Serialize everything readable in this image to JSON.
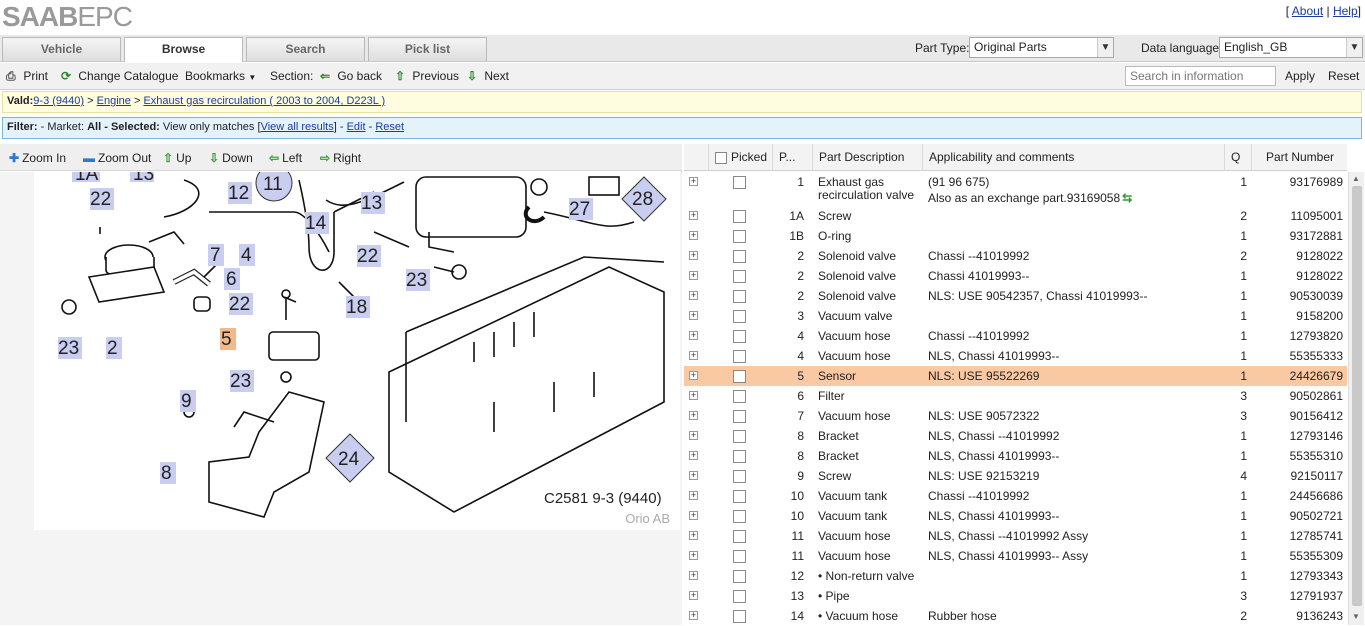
{
  "header": {
    "logo_saab": "SAAB",
    "logo_epc": "EPC",
    "about": "About",
    "help": "Help",
    "sep_open": "[",
    "sep_mid": "|",
    "sep_close": "]"
  },
  "tabs": [
    {
      "label": "Vehicle"
    },
    {
      "label": "Browse"
    },
    {
      "label": "Search"
    },
    {
      "label": "Pick list"
    }
  ],
  "part_type": {
    "label": "Part Type:",
    "value": "Original Parts"
  },
  "data_language": {
    "label": "Data language:",
    "value": "English_GB"
  },
  "toolbar": {
    "print": "Print",
    "change_catalogue": "Change Catalogue",
    "bookmarks": "Bookmarks",
    "section": "Section:",
    "go_back": "Go back",
    "previous": "Previous",
    "next": "Next",
    "search_placeholder": "Search in information",
    "apply": "Apply",
    "reset": "Reset"
  },
  "valid_bar": {
    "prefix": "Vald:",
    "crumb1": "9-3 (9440)",
    "crumb2": "Engine",
    "crumb3": "Exhaust gas recirculation ( 2003 to 2004, D223L )",
    "sep": ">"
  },
  "filter_bar": {
    "prefix": "Filter:",
    "market_label": "- Market:",
    "market_value": "All",
    "selected_label": "- Selected:",
    "selected_value": "View only matches",
    "view_all": "View all results",
    "edit": "Edit",
    "reset": "Reset"
  },
  "zoom_bar": {
    "zoom_in": "Zoom In",
    "zoom_out": "Zoom Out",
    "up": "Up",
    "down": "Down",
    "left": "Left",
    "right": "Right"
  },
  "diagram": {
    "caption": "C2581 9-3 (9440)",
    "credit": "Orio AB",
    "callouts": [
      "1A",
      "13",
      "22",
      "12",
      "11",
      "14",
      "13",
      "27",
      "28",
      "7",
      "4",
      "22",
      "6",
      "22",
      "23",
      "2",
      "18",
      "5",
      "23",
      "9",
      "8",
      "24",
      "23"
    ]
  },
  "table": {
    "headers": {
      "picked": "Picked",
      "pos": "P...",
      "desc": "Part Description",
      "comments": "Applicability and comments",
      "qty": "Q",
      "partno": "Part Number"
    },
    "rows": [
      {
        "pos": "1",
        "desc": "Exhaust gas",
        "desc2": "recirculation valve",
        "comment": "(91 96 675)",
        "comment2": "Also as an exchange part.93169058",
        "qty": "1",
        "partno": "93176989"
      },
      {
        "pos": "1A",
        "desc": "Screw",
        "comment": "",
        "qty": "2",
        "partno": "11095001"
      },
      {
        "pos": "1B",
        "desc": "O-ring",
        "comment": "",
        "qty": "1",
        "partno": "93172881"
      },
      {
        "pos": "2",
        "desc": "Solenoid valve",
        "comment": "Chassi --41019992",
        "qty": "2",
        "partno": "9128022"
      },
      {
        "pos": "2",
        "desc": "Solenoid valve",
        "comment": "Chassi 41019993--",
        "qty": "1",
        "partno": "9128022"
      },
      {
        "pos": "2",
        "desc": "Solenoid valve",
        "comment": "NLS: USE 90542357, Chassi 41019993--",
        "qty": "1",
        "partno": "90530039"
      },
      {
        "pos": "3",
        "desc": "Vacuum valve",
        "comment": "",
        "qty": "1",
        "partno": "9158200"
      },
      {
        "pos": "4",
        "desc": "Vacuum hose",
        "comment": "Chassi --41019992",
        "qty": "1",
        "partno": "12793820"
      },
      {
        "pos": "4",
        "desc": "Vacuum hose",
        "comment": "NLS, Chassi 41019993--",
        "qty": "1",
        "partno": "55355333"
      },
      {
        "pos": "5",
        "desc": "Sensor",
        "comment": "NLS: USE 95522269",
        "qty": "1",
        "partno": "24426679",
        "selected": true
      },
      {
        "pos": "6",
        "desc": "Filter",
        "comment": "",
        "qty": "3",
        "partno": "90502861"
      },
      {
        "pos": "7",
        "desc": "Vacuum hose",
        "comment": "NLS: USE 90572322",
        "qty": "3",
        "partno": "90156412"
      },
      {
        "pos": "8",
        "desc": "Bracket",
        "comment": "NLS, Chassi --41019992",
        "qty": "1",
        "partno": "12793146"
      },
      {
        "pos": "8",
        "desc": "Bracket",
        "comment": "NLS, Chassi 41019993--",
        "qty": "1",
        "partno": "55355310"
      },
      {
        "pos": "9",
        "desc": "Screw",
        "comment": "NLS: USE 92153219",
        "qty": "4",
        "partno": "92150117"
      },
      {
        "pos": "10",
        "desc": "Vacuum tank",
        "comment": "Chassi --41019992",
        "qty": "1",
        "partno": "24456686"
      },
      {
        "pos": "10",
        "desc": "Vacuum tank",
        "comment": "NLS, Chassi 41019993--",
        "qty": "1",
        "partno": "90502721"
      },
      {
        "pos": "11",
        "desc": "Vacuum hose",
        "comment": "NLS, Chassi --41019992 Assy",
        "qty": "1",
        "partno": "12785741"
      },
      {
        "pos": "11",
        "desc": "Vacuum hose",
        "comment": "NLS, Chassi 41019993-- Assy",
        "qty": "1",
        "partno": "55355309"
      },
      {
        "pos": "12",
        "desc": "• Non-return valve",
        "comment": "",
        "qty": "1",
        "partno": "12793343"
      },
      {
        "pos": "13",
        "desc": "• Pipe",
        "comment": "",
        "qty": "3",
        "partno": "12791937"
      },
      {
        "pos": "14",
        "desc": "• Vacuum hose",
        "comment": "Rubber hose",
        "qty": "2",
        "partno": "9136243"
      }
    ]
  },
  "colors": {
    "selected_row": "#f8c9a3",
    "valid_bar": "#fffde0",
    "filter_bar": "#e4f2fb",
    "callout_bg": "#c9cdf0",
    "callout_highlight": "#f3b98c"
  }
}
